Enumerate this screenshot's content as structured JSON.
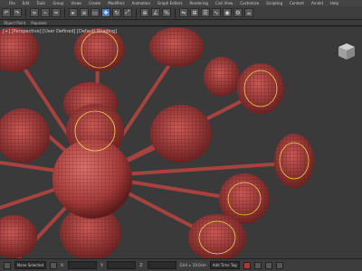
{
  "menu": [
    "File",
    "Edit",
    "Tools",
    "Group",
    "Views",
    "Create",
    "Modifiers",
    "Animation",
    "Graph Editors",
    "Rendering",
    "Civil View",
    "Customize",
    "Scripting",
    "Content",
    "Arnold",
    "Help"
  ],
  "ribbon": [
    "Object Paint",
    "Populate"
  ],
  "viewport": {
    "label": "[+] [Perspective] [User Defined] [Default Shading]"
  },
  "status": {
    "selection": "None Selected",
    "grid": "Grid = 10.0cm",
    "addtimetag": "Add Time Tag",
    "x_label": "X:",
    "y_label": "Y:",
    "z_label": "Z:"
  },
  "colors": {
    "model": "#b84a48",
    "model_dark": "#6b1f1f",
    "selection": "#f0d24a",
    "viewport_bg": "#3a3a3a"
  }
}
